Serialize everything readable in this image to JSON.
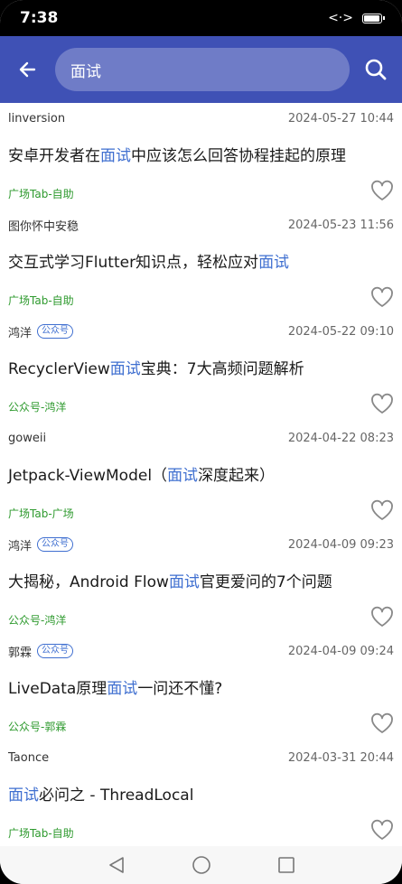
{
  "status": {
    "time": "7:38",
    "net": "<·>"
  },
  "search": {
    "query": "面试"
  },
  "articles": [
    {
      "author": "linversion",
      "badge": "",
      "date": "2024-05-27 10:44",
      "title_pre": "安卓开发者在",
      "title_hl": "面试",
      "title_post": "中应该怎么回答协程挂起的原理",
      "chapter": "广场Tab-自助"
    },
    {
      "author": "图你怀中安稳",
      "badge": "",
      "date": "2024-05-23 11:56",
      "title_pre": "交互式学习Flutter知识点，轻松应对",
      "title_hl": "面试",
      "title_post": "",
      "chapter": "广场Tab-自助"
    },
    {
      "author": "鸿洋",
      "badge": "公众号",
      "date": "2024-05-22 09:10",
      "title_pre": "RecyclerView",
      "title_hl": "面试",
      "title_post": "宝典：7大高频问题解析",
      "chapter": "公众号-鸿洋"
    },
    {
      "author": "goweii",
      "badge": "",
      "date": "2024-04-22 08:23",
      "title_pre": "Jetpack-ViewModel（",
      "title_hl": "面试",
      "title_post": "深度起来）",
      "chapter": "广场Tab-广场"
    },
    {
      "author": "鸿洋",
      "badge": "公众号",
      "date": "2024-04-09 09:23",
      "title_pre": "大揭秘，Android Flow",
      "title_hl": "面试",
      "title_post": "官更爱问的7个问题",
      "chapter": "公众号-鸿洋"
    },
    {
      "author": "郭霖",
      "badge": "公众号",
      "date": "2024-04-09 09:24",
      "title_pre": "LiveData原理",
      "title_hl": "面试",
      "title_post": "一问还不懂?",
      "chapter": "公众号-郭霖"
    },
    {
      "author": "Taonce",
      "badge": "",
      "date": "2024-03-31 20:44",
      "title_pre": "",
      "title_hl": "面试",
      "title_post": "必问之 - ThreadLocal",
      "chapter": "广场Tab-自助"
    }
  ],
  "colors": {
    "appbar": "#3f51b5",
    "highlight": "#3f6fd0",
    "chapter": "#2e9a2e"
  }
}
